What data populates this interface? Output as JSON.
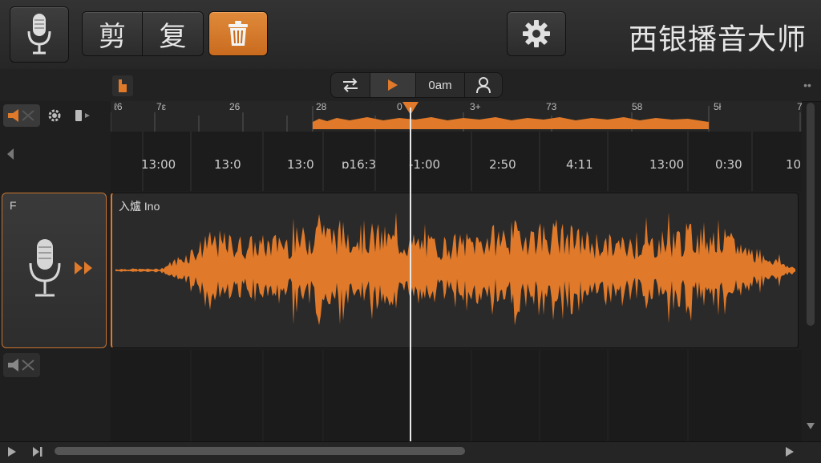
{
  "toolbar": {
    "cut_label": "剪",
    "copy_label": "复",
    "app_title": "西银播音大师"
  },
  "subbar": {
    "time_readout": "0am"
  },
  "overview_ruler": {
    "ticks": [
      "ℓ6",
      "7ε",
      "26",
      "28",
      "0",
      "3+",
      "73",
      "58",
      "5ł",
      "7"
    ]
  },
  "time_ruler": {
    "labels": [
      "13:00",
      "13:0",
      "13:0",
      "ɒ16:3",
      "-1:00",
      "2:50",
      "4:11",
      "13:00",
      "0:30",
      "10"
    ]
  },
  "track": {
    "name": "入爐 Ino",
    "head_label": "F"
  },
  "colors": {
    "accent": "#e07a2a",
    "background": "#1e1e1e"
  }
}
